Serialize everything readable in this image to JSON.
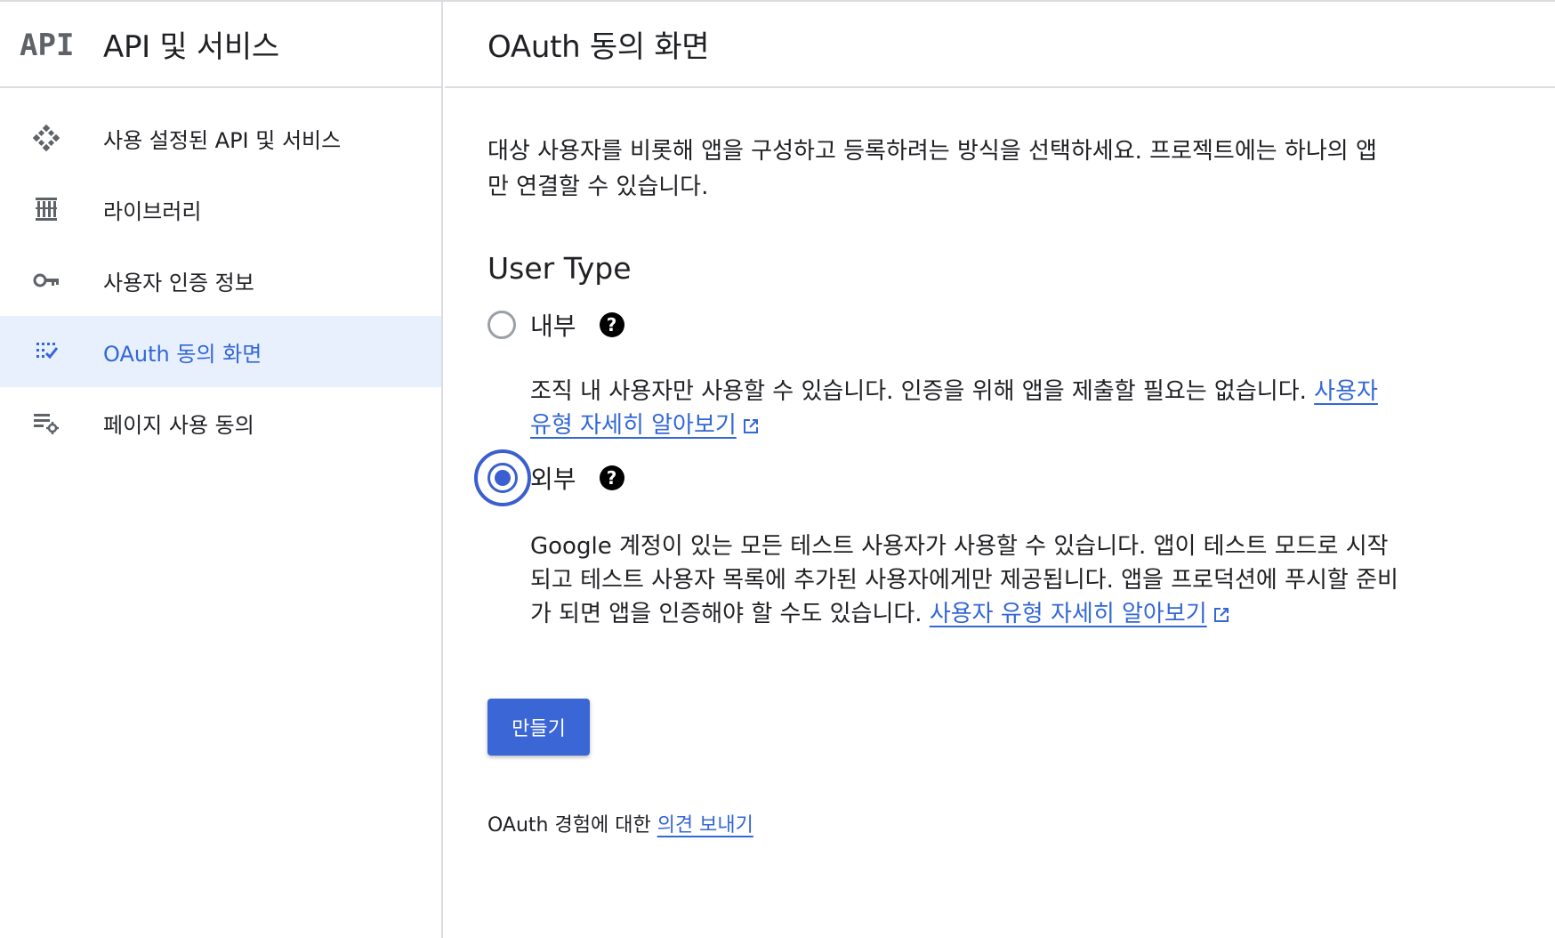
{
  "sidebar": {
    "logo_text": "API",
    "title": "API 및 서비스",
    "items": [
      {
        "label": "사용 설정된 API 및 서비스",
        "icon": "diamond-grid-icon"
      },
      {
        "label": "라이브러리",
        "icon": "library-icon"
      },
      {
        "label": "사용자 인증 정보",
        "icon": "key-icon"
      },
      {
        "label": "OAuth 동의 화면",
        "icon": "consent-grid-icon",
        "active": true
      },
      {
        "label": "페이지 사용 동의",
        "icon": "list-settings-icon"
      }
    ]
  },
  "main": {
    "title": "OAuth 동의 화면",
    "description": "대상 사용자를 비롯해 앱을 구성하고 등록하려는 방식을 선택하세요. 프로젝트에는 하나의 앱만 연결할 수 있습니다.",
    "user_type": {
      "title": "User Type",
      "options": [
        {
          "label": "내부",
          "selected": false,
          "description": "조직 내 사용자만 사용할 수 있습니다. 인증을 위해 앱을 제출할 필요는 없습니다. ",
          "link": "사용자 유형 자세히 알아보기"
        },
        {
          "label": "외부",
          "selected": true,
          "description": "Google 계정이 있는 모든 테스트 사용자가 사용할 수 있습니다. 앱이 테스트 모드로 시작되고 테스트 사용자 목록에 추가된 사용자에게만 제공됩니다. 앱을 프로덕션에 푸시할 준비가 되면 앱을 인증해야 할 수도 있습니다. ",
          "link": "사용자 유형 자세히 알아보기"
        }
      ]
    },
    "create_button": "만들기",
    "feedback": {
      "prefix": "OAuth 경험에 대한 ",
      "link": "의견 보내기"
    }
  },
  "colors": {
    "accent": "#3367d6",
    "button": "#3b66d6",
    "active_bg": "#e8f0fe",
    "border": "#dadce0"
  }
}
